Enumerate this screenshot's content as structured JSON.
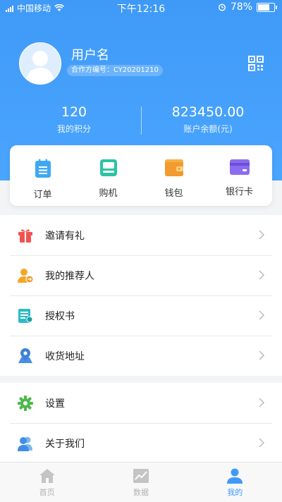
{
  "status_bar": {
    "carrier": "中国移动",
    "time": "下午12:16",
    "battery": "78%",
    "battery_fraction": 0.78
  },
  "profile": {
    "username": "用户名",
    "coop_id": "合作方编号：CY20201210"
  },
  "stats": [
    {
      "value": "120",
      "label": "我的积分"
    },
    {
      "value": "823450.00",
      "label": "账户余额(元)"
    }
  ],
  "quick_actions": [
    {
      "label": "订单",
      "icon": "order-icon",
      "color": "#3fa8f5"
    },
    {
      "label": "购机",
      "icon": "pos-machine-icon",
      "color": "#2cc3a2"
    },
    {
      "label": "钱包",
      "icon": "wallet-icon",
      "color": "#f5b044"
    },
    {
      "label": "银行卡",
      "icon": "bank-card-icon",
      "color": "#8b6cf0"
    }
  ],
  "menu_group1": [
    {
      "label": "邀请有礼",
      "icon": "gift-icon"
    },
    {
      "label": "我的推荐人",
      "icon": "referrer-icon"
    },
    {
      "label": "授权书",
      "icon": "authorization-icon"
    },
    {
      "label": "收货地址",
      "icon": "address-icon"
    }
  ],
  "menu_group2": [
    {
      "label": "设置",
      "icon": "settings-icon"
    },
    {
      "label": "关于我们",
      "icon": "about-icon"
    }
  ],
  "tabbar": [
    {
      "label": "首页",
      "icon": "home-icon",
      "active": false
    },
    {
      "label": "数据",
      "icon": "chart-icon",
      "active": false
    },
    {
      "label": "我的",
      "icon": "profile-icon",
      "active": true
    }
  ],
  "colors": {
    "primary": "#3f9af7",
    "background": "#f3f4f6"
  }
}
